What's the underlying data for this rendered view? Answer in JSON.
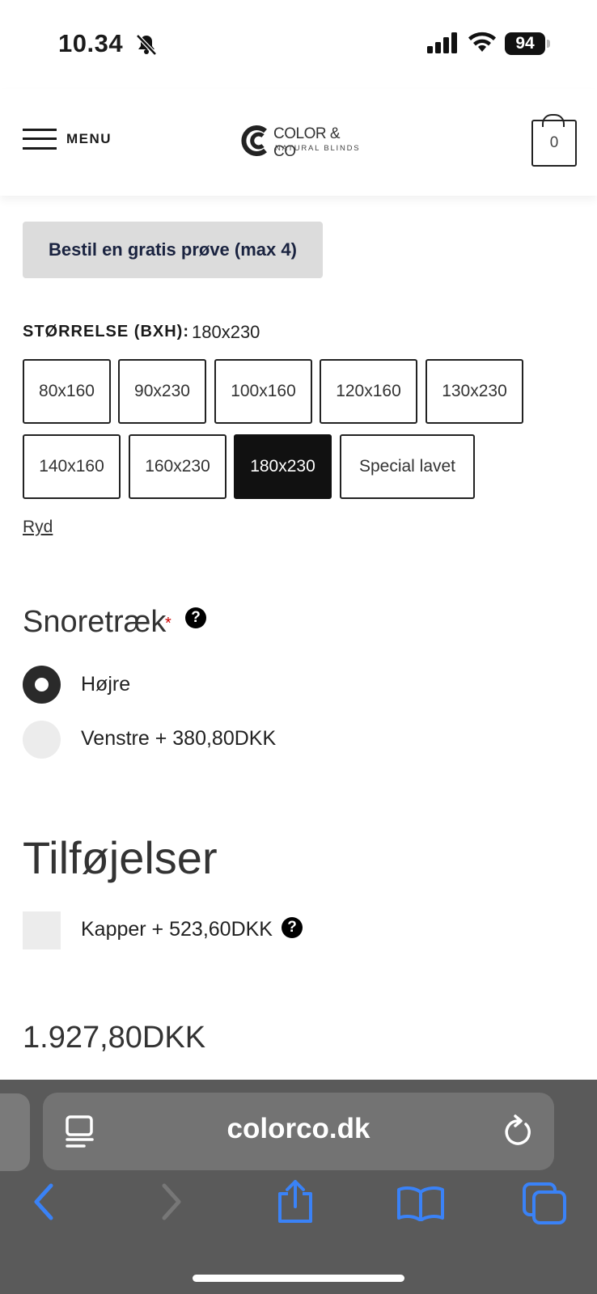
{
  "status": {
    "time": "10.34",
    "battery": "94"
  },
  "header": {
    "menu_label": "MENU",
    "logo_line1": "COLOR & CO",
    "logo_line2": "NATURAL BLINDS",
    "cart_count": "0"
  },
  "sample_button": "Bestil en gratis prøve (max 4)",
  "size": {
    "label": "STØRRELSE (BXH):",
    "selected": "180x230",
    "options": [
      "80x160",
      "90x230",
      "100x160",
      "120x160",
      "130x230",
      "140x160",
      "160x230",
      "180x230",
      "Special lavet"
    ],
    "clear": "Ryd"
  },
  "cord": {
    "title": "Snoretræk",
    "required_mark": "*",
    "options": [
      {
        "label": "Højre",
        "selected": true
      },
      {
        "label": "Venstre + 380,80DKK",
        "selected": false
      }
    ]
  },
  "addons": {
    "title": "Tilføjelser",
    "items": [
      {
        "label": "Kapper + 523,60DKK",
        "checked": false
      }
    ]
  },
  "price": "1.927,80DKK",
  "browser": {
    "url": "colorco.dk"
  },
  "colors": {
    "selected_swatch": "#111111",
    "ios_blue": "#3a82f7",
    "toolbar_bg": "#5a5a5a"
  }
}
